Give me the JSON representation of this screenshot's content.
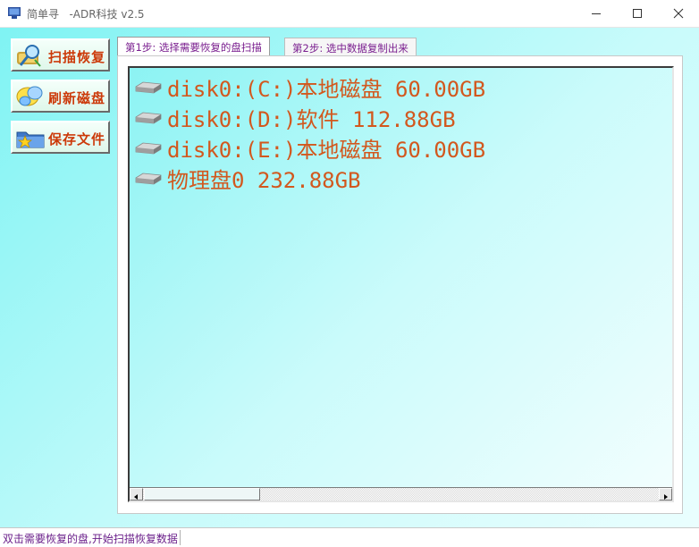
{
  "window": {
    "title": "简单寻   -ADR科技 v2.5",
    "controls": [
      "minimize",
      "maximize",
      "close"
    ]
  },
  "sidebar": {
    "buttons": [
      {
        "label": "扫描恢复",
        "icon": "magnifier-disk-icon"
      },
      {
        "label": "刷新磁盘",
        "icon": "refresh-bubbles-icon"
      },
      {
        "label": "保存文件",
        "icon": "save-folder-icon"
      }
    ]
  },
  "tabs": [
    {
      "label": "第1步: 选择需要恢复的盘扫描",
      "active": true
    },
    {
      "label": "第2步: 选中数据复制出来",
      "active": false
    }
  ],
  "drives": [
    {
      "label": "disk0:(C:)本地磁盘 60.00GB",
      "icon": "hard-drive-icon"
    },
    {
      "label": "disk0:(D:)软件 112.88GB",
      "icon": "hard-drive-icon"
    },
    {
      "label": "disk0:(E:)本地磁盘 60.00GB",
      "icon": "hard-drive-icon"
    },
    {
      "label": "物理盘0 232.88GB",
      "icon": "hard-drive-icon"
    }
  ],
  "status": {
    "text": "双击需要恢复的盘,开始扫描恢复数据"
  },
  "colors": {
    "accent_text": "#d2581e",
    "button_text": "#cc3a0a",
    "tab_text": "#7a1f8f",
    "background": "#7ff3f3"
  }
}
